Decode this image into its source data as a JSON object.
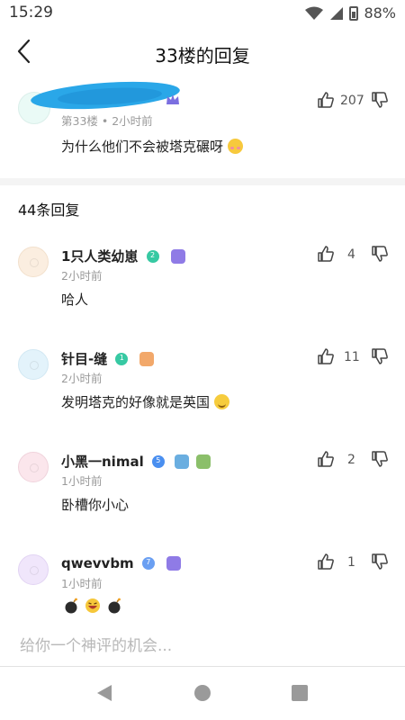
{
  "status": {
    "time": "15:29",
    "battery": "88%"
  },
  "header": {
    "title": "33楼的回复"
  },
  "main_post": {
    "meta": "第33楼 • 2小时前",
    "text": "为什么他们不会被塔克碾呀",
    "likes": "207"
  },
  "replies_title": "44条回复",
  "replies": [
    {
      "name": "1只人类幼崽",
      "level": "2",
      "time": "2小时前",
      "text": "哈人",
      "likes": "4"
    },
    {
      "name": "针目-缝",
      "level": "1",
      "time": "2小时前",
      "text": "发明塔克的好像就是英国",
      "likes": "11"
    },
    {
      "name": "小黑一nimal",
      "level": "5",
      "time": "1小时前",
      "text": "卧槽你小心",
      "likes": "2"
    },
    {
      "name": "qwevvbm",
      "level": "7",
      "time": "1小时前",
      "text": "",
      "likes": "1"
    }
  ],
  "input": {
    "placeholder": "给你一个神评的机会..."
  },
  "colors": {
    "accent": "#2aa7e8",
    "divider": "#f4f4f4"
  }
}
